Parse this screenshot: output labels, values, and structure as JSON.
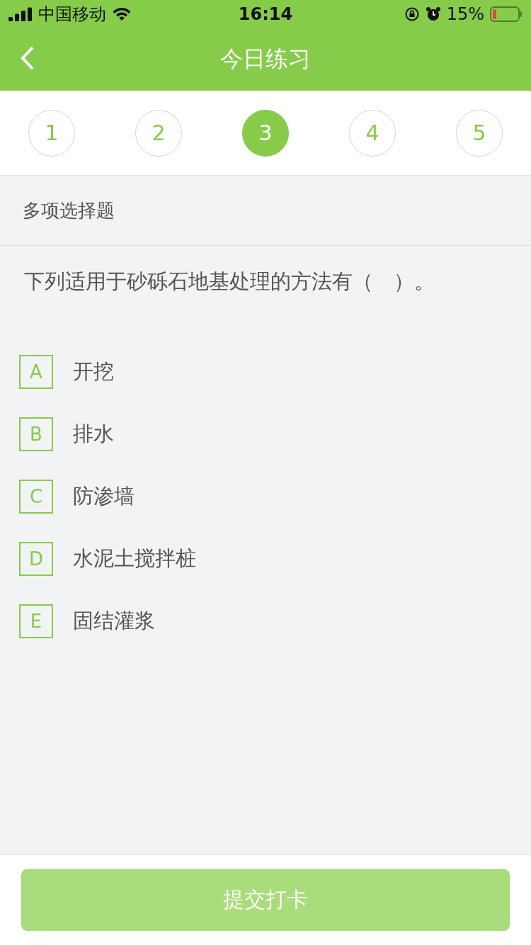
{
  "status_bar": {
    "carrier": "中国移动",
    "time": "16:14",
    "battery": "15%"
  },
  "nav": {
    "title": "今日练习"
  },
  "steps": [
    {
      "label": "1",
      "selected": false
    },
    {
      "label": "2",
      "selected": false
    },
    {
      "label": "3",
      "selected": true
    },
    {
      "label": "4",
      "selected": false
    },
    {
      "label": "5",
      "selected": false
    }
  ],
  "question_type": "多项选择题",
  "question": "下列适用于砂砾石地基处理的方法有（　）。",
  "options": [
    {
      "letter": "A",
      "text": "开挖",
      "selected": false
    },
    {
      "letter": "B",
      "text": "排水",
      "selected": false
    },
    {
      "letter": "C",
      "text": "防渗墙",
      "selected": false
    },
    {
      "letter": "D",
      "text": "水泥土搅拌桩",
      "selected": false
    },
    {
      "letter": "E",
      "text": "固结灌浆",
      "selected": false
    }
  ],
  "submit": {
    "label": "提交打卡",
    "disabled": true
  }
}
